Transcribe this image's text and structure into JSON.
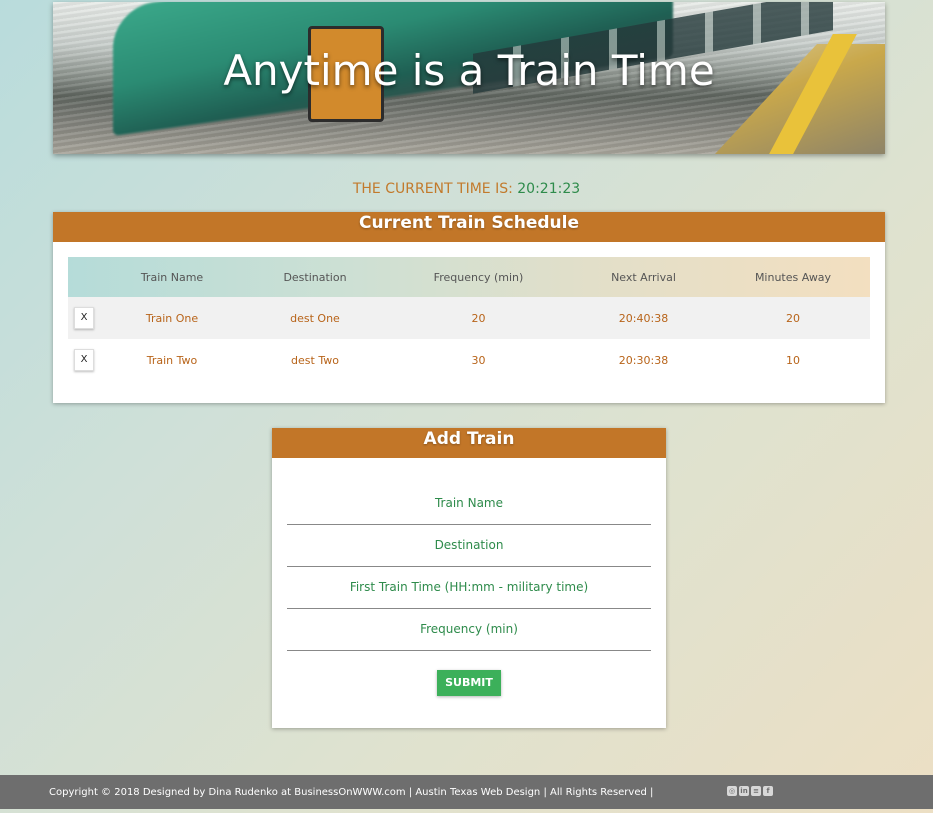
{
  "header": {
    "title": "Anytime is a Train Time"
  },
  "clock": {
    "label": "THE CURRENT TIME IS:",
    "time": "20:21:23"
  },
  "schedule": {
    "title": "Current Train Schedule",
    "columns": [
      "",
      "Train Name",
      "Destination",
      "Frequency (min)",
      "Next Arrival",
      "Minutes Away"
    ],
    "rows": [
      {
        "remove": "X",
        "name": "Train One",
        "destination": "dest One",
        "frequency": "20",
        "next_arrival": "20:40:38",
        "minutes_away": "20"
      },
      {
        "remove": "X",
        "name": "Train Two",
        "destination": "dest Two",
        "frequency": "30",
        "next_arrival": "20:30:38",
        "minutes_away": "10"
      }
    ]
  },
  "add_train": {
    "title": "Add Train",
    "fields": {
      "name": "Train Name",
      "destination": "Destination",
      "first_time": "First Train Time (HH:mm - military time)",
      "frequency": "Frequency (min)"
    },
    "submit": "SUBMIT"
  },
  "footer": {
    "copyright": "Copyright © 2018 Designed by Dina Rudenko at BusinessOnWWW.com | Austin Texas Web Design | All Rights Reserved |",
    "icons": [
      "instagram-icon",
      "linkedin-icon",
      "stackoverflow-icon",
      "facebook-icon"
    ]
  },
  "colors": {
    "accent": "#c27628",
    "green": "#2e8b4b",
    "submit": "#3cb05a"
  }
}
